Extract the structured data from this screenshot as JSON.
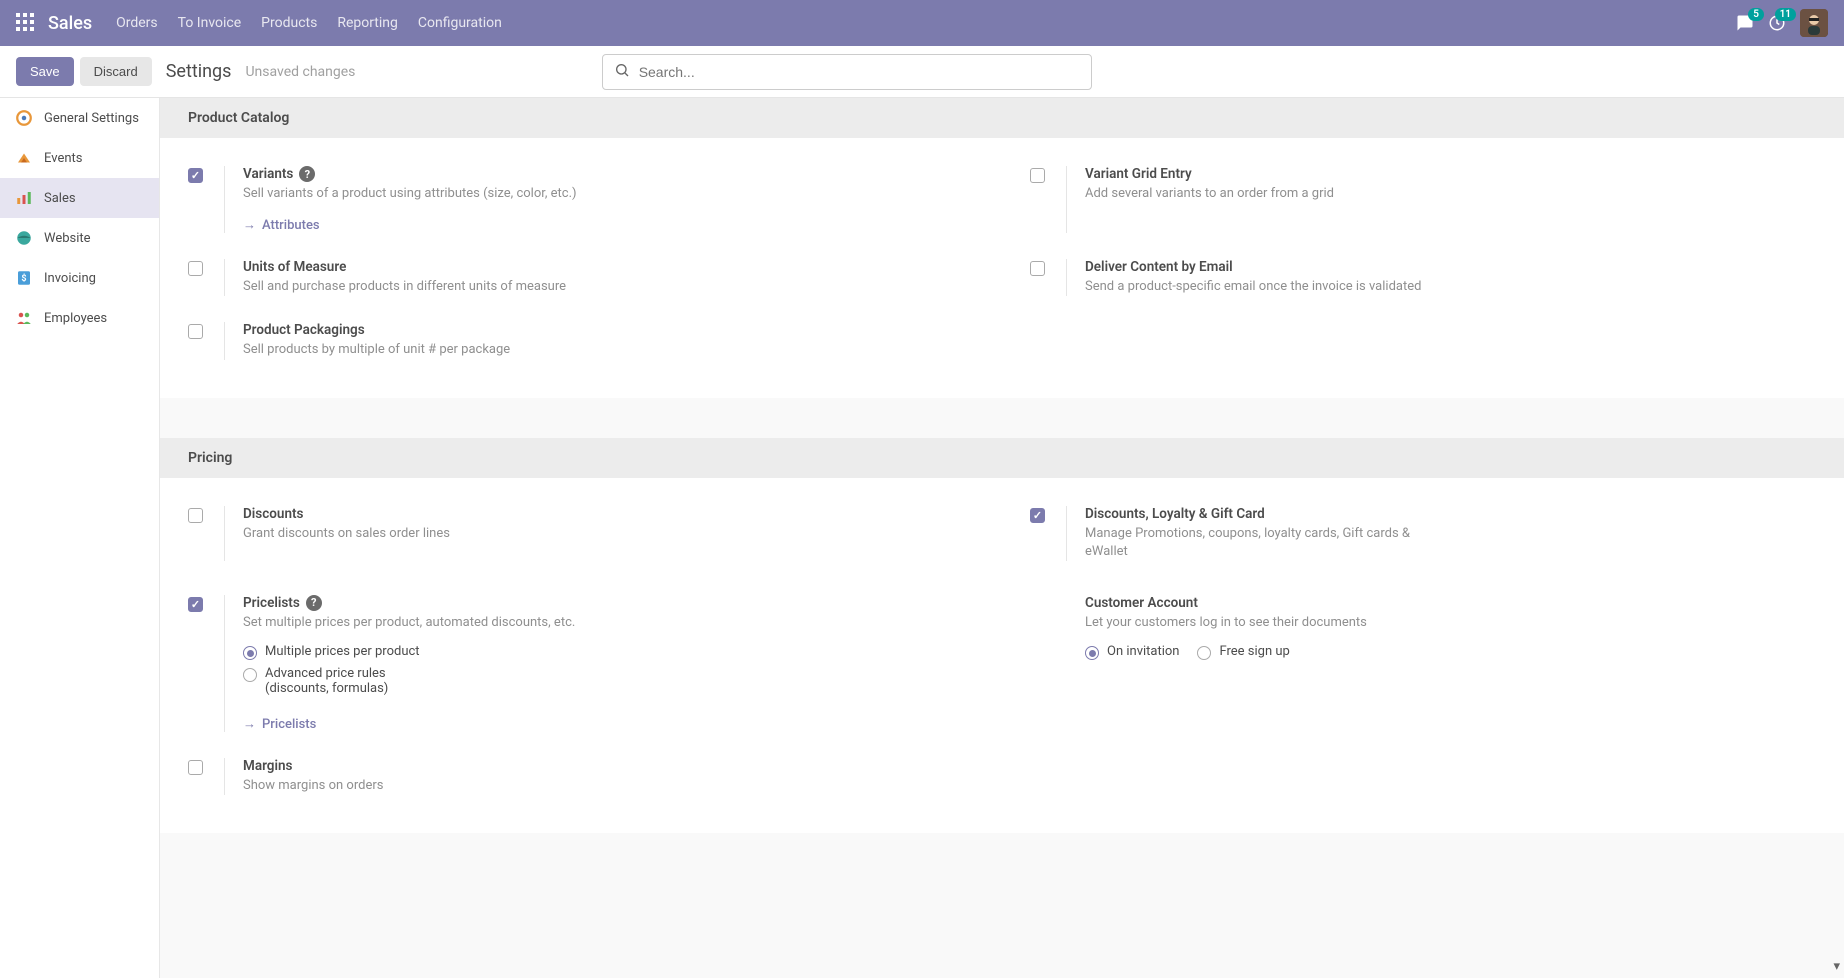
{
  "topnav": {
    "brand": "Sales",
    "items": [
      "Orders",
      "To Invoice",
      "Products",
      "Reporting",
      "Configuration"
    ],
    "messages_count": "5",
    "activities_count": "11"
  },
  "controlbar": {
    "save": "Save",
    "discard": "Discard",
    "title": "Settings",
    "subtitle": "Unsaved changes",
    "search_placeholder": "Search..."
  },
  "sidebar": {
    "items": [
      {
        "label": "General Settings"
      },
      {
        "label": "Events"
      },
      {
        "label": "Sales"
      },
      {
        "label": "Website"
      },
      {
        "label": "Invoicing"
      },
      {
        "label": "Employees"
      }
    ]
  },
  "sections": {
    "product_catalog": {
      "title": "Product Catalog",
      "variants": {
        "title": "Variants",
        "desc": "Sell variants of a product using attributes (size, color, etc.)",
        "link": "Attributes"
      },
      "variant_grid": {
        "title": "Variant Grid Entry",
        "desc": "Add several variants to an order from a grid"
      },
      "uom": {
        "title": "Units of Measure",
        "desc": "Sell and purchase products in different units of measure"
      },
      "deliver_email": {
        "title": "Deliver Content by Email",
        "desc": "Send a product-specific email once the invoice is validated"
      },
      "packagings": {
        "title": "Product Packagings",
        "desc": "Sell products by multiple of unit # per package"
      }
    },
    "pricing": {
      "title": "Pricing",
      "discounts": {
        "title": "Discounts",
        "desc": "Grant discounts on sales order lines"
      },
      "loyalty": {
        "title": "Discounts, Loyalty & Gift Card",
        "desc": "Manage Promotions, coupons, loyalty cards, Gift cards & eWallet"
      },
      "pricelists": {
        "title": "Pricelists",
        "desc": "Set multiple prices per product, automated discounts, etc.",
        "r1": "Multiple prices per product",
        "r2a": "Advanced price rules",
        "r2b": "(discounts, formulas)",
        "link": "Pricelists"
      },
      "customer_account": {
        "title": "Customer Account",
        "desc": "Let your customers log in to see their documents",
        "r1": "On invitation",
        "r2": "Free sign up"
      },
      "margins": {
        "title": "Margins",
        "desc": "Show margins on orders"
      }
    }
  }
}
